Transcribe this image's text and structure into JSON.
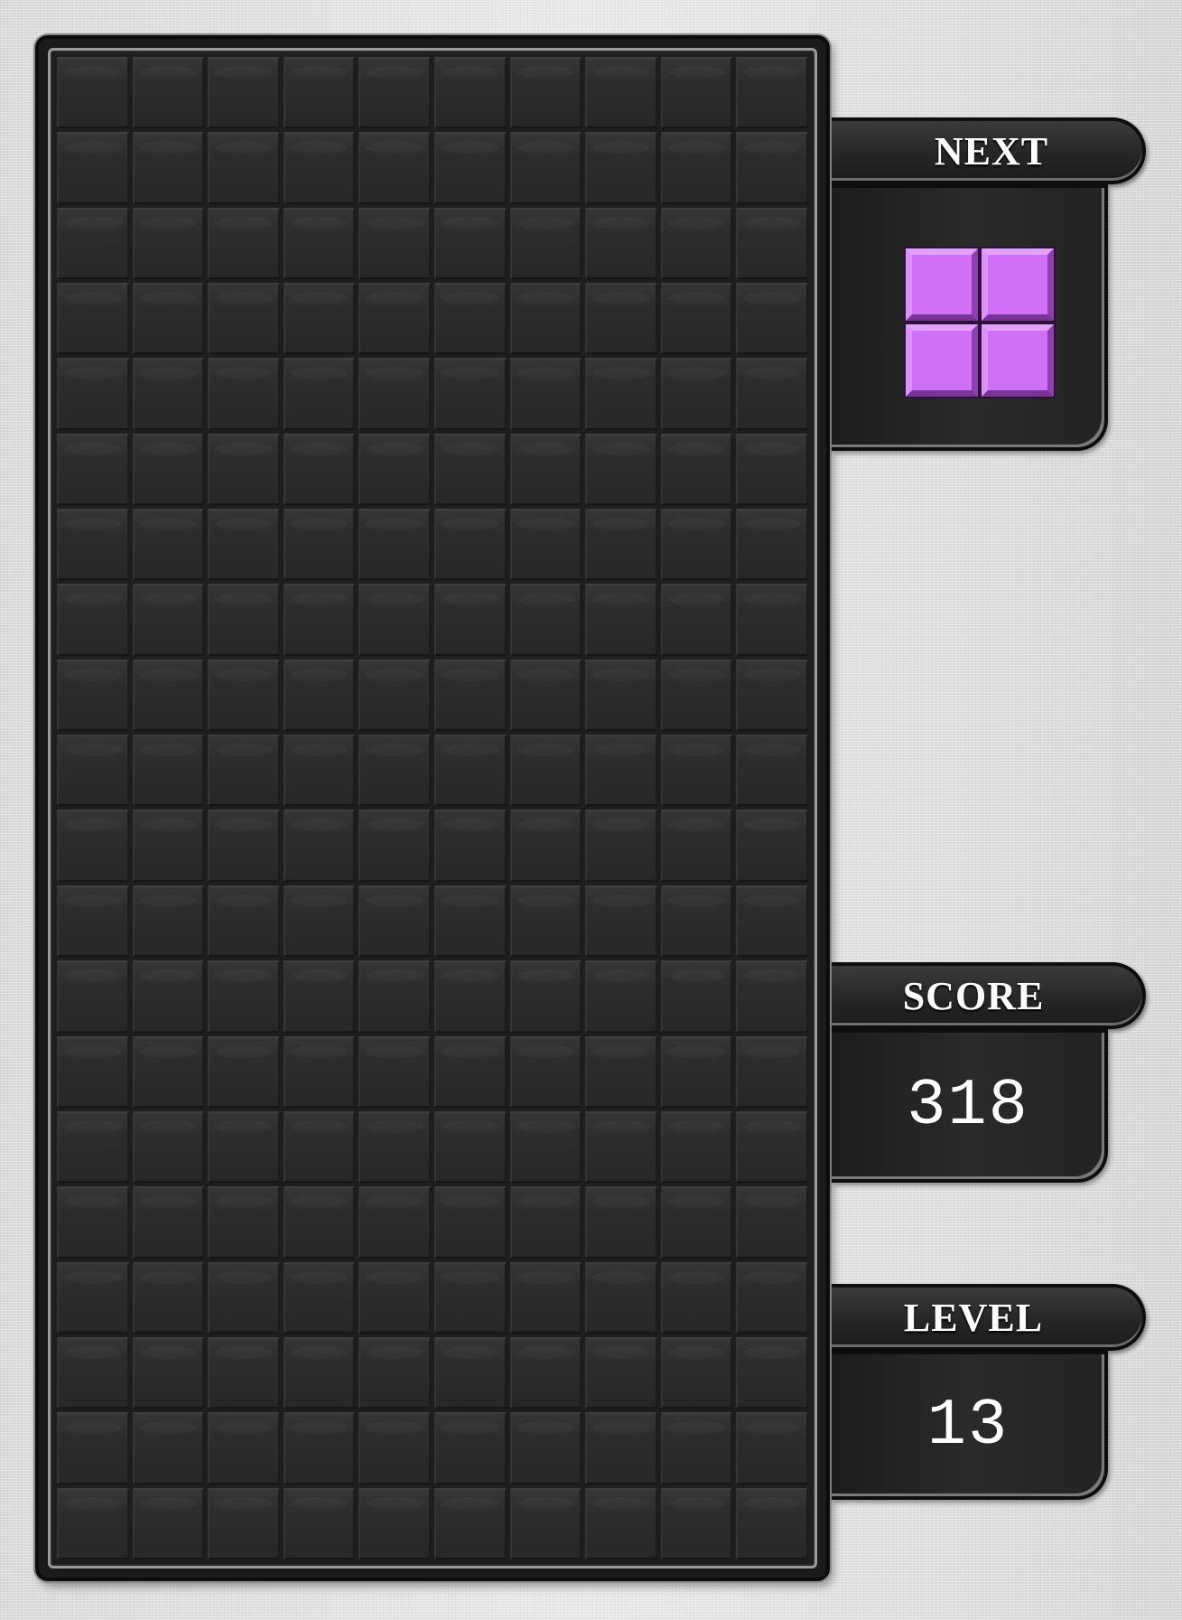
{
  "board": {
    "columns": 10,
    "rows": 20,
    "filled_cells": []
  },
  "next": {
    "label": "NEXT",
    "piece": "O",
    "piece_color": "#d070f6",
    "blocks": [
      [
        0,
        0
      ],
      [
        1,
        0
      ],
      [
        0,
        1
      ],
      [
        1,
        1
      ]
    ]
  },
  "score": {
    "label": "SCORE",
    "value": "318"
  },
  "level": {
    "label": "LEVEL",
    "value": "13"
  },
  "colors": {
    "background": "#dcdcdc",
    "board": "#1e1e1e",
    "empty_cell": "#2d2d2d",
    "panel": "#262626",
    "text": "#ffffff"
  }
}
